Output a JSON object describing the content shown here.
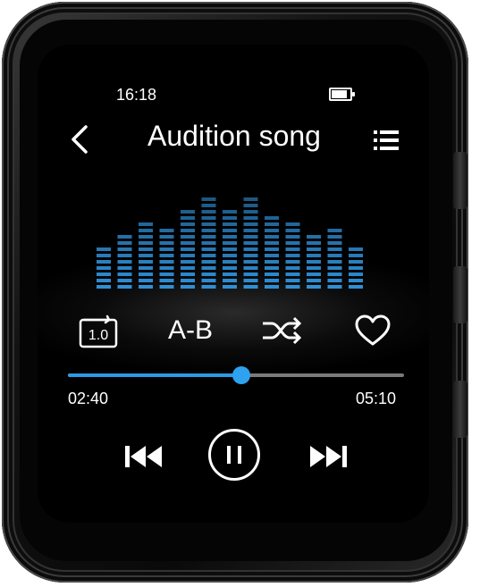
{
  "status": {
    "time": "16:18",
    "battery_level": 0.85
  },
  "header": {
    "title": "Audition song",
    "back_icon": "chevron-left-icon",
    "playlist_icon": "playlist-icon"
  },
  "controls": {
    "speed_label": "1.0",
    "ab_label": "A-B",
    "shuffle_icon": "shuffle-icon",
    "favorite_icon": "heart-icon"
  },
  "progress": {
    "elapsed": "02:40",
    "total": "05:10",
    "fraction": 0.516
  },
  "playback": {
    "prev_icon": "skip-previous-icon",
    "pause_icon": "pause-icon",
    "next_icon": "skip-next-icon"
  },
  "visualizer": {
    "accent_color": "#2f8fd6",
    "levels": [
      7,
      9,
      11,
      10,
      13,
      15,
      13,
      15,
      12,
      11,
      9,
      10,
      7
    ]
  },
  "colors": {
    "accent": "#2b9be6",
    "track": "#7a7a7a"
  }
}
